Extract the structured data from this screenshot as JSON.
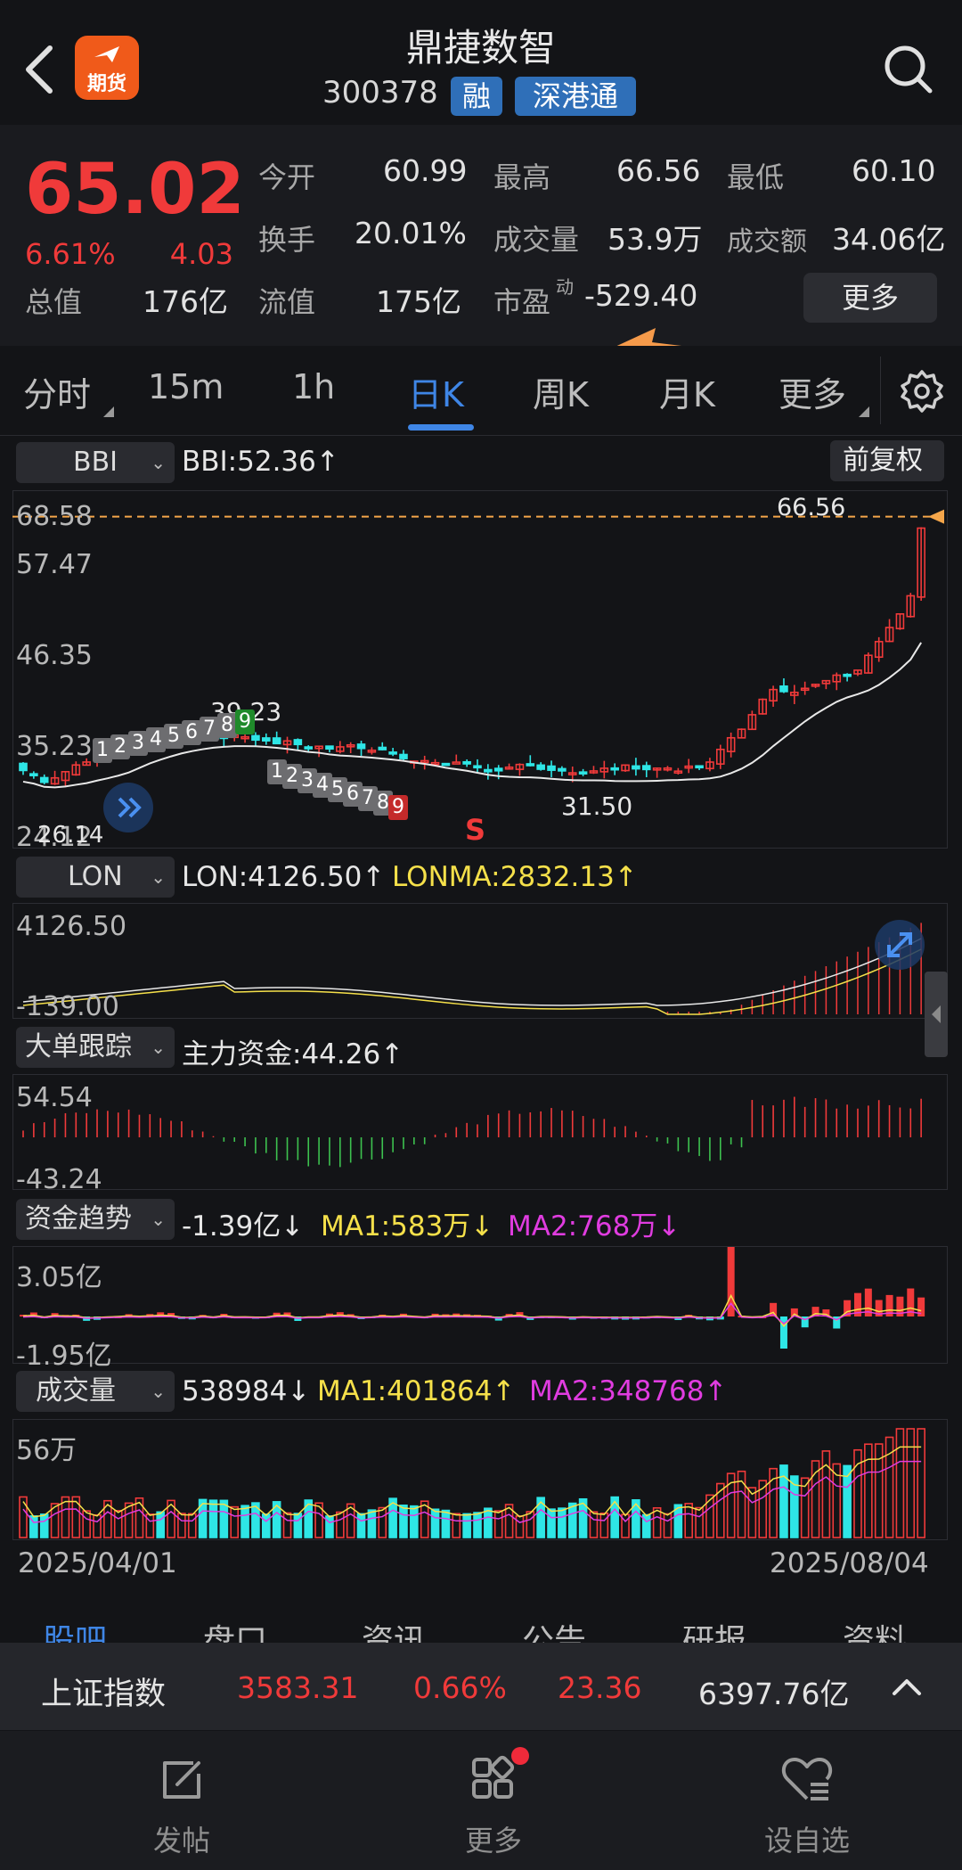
{
  "header": {
    "logo_text": "期货",
    "stock_name": "鼎捷数智",
    "stock_code": "300378",
    "tags": [
      "融",
      "深港通"
    ]
  },
  "quote": {
    "price": "65.02",
    "change_pct": "6.61%",
    "change_amt": "4.03",
    "total_value_label": "总值",
    "total_value": "176亿",
    "rows": [
      [
        {
          "label": "今开",
          "value": "60.99"
        },
        {
          "label": "最高",
          "value": "66.56"
        },
        {
          "label": "最低",
          "value": "60.10"
        }
      ],
      [
        {
          "label": "换手",
          "value": "20.01%"
        },
        {
          "label": "成交量",
          "value": "53.9万"
        },
        {
          "label": "成交额",
          "value": "34.06亿"
        }
      ],
      [
        {
          "label": "流值",
          "value": "175亿"
        },
        {
          "label": "市盈",
          "sup": "动",
          "value": "-529.40"
        }
      ]
    ],
    "more_button": "更多"
  },
  "period_tabs": [
    "分时",
    "15m",
    "1h",
    "日K",
    "周K",
    "月K",
    "更多"
  ],
  "active_tab": "日K",
  "main_chart": {
    "indicator": "BBI",
    "indicator_value": "BBI:52.36↑",
    "adjust_button": "前复权",
    "y_labels": [
      "68.58",
      "57.47",
      "46.35",
      "35.23",
      "24.12"
    ],
    "high_label": "66.56",
    "marker_39": "39.23",
    "marker_low": "31.50",
    "marker_26": "26.14",
    "s_marker": "S",
    "td_bottom_seq": [
      "1",
      "2",
      "3",
      "4",
      "5",
      "6",
      "7",
      "8",
      "9"
    ],
    "td_top_seq": [
      "1",
      "2",
      "3",
      "4",
      "5",
      "6",
      "7",
      "8",
      "9"
    ]
  },
  "lon_panel": {
    "indicator": "LON",
    "value1": "LON:4126.50↑",
    "value2": "LONMA:2832.13↑",
    "y_top": "4126.50",
    "y_bottom": "-139.00"
  },
  "big_order_panel": {
    "indicator": "大单跟踪",
    "value1": "主力资金:44.26↑",
    "y_top": "54.54",
    "y_bottom": "-43.24"
  },
  "fund_trend_panel": {
    "indicator": "资金趋势",
    "value1": "-1.39亿↓",
    "value2": "MA1:583万↓",
    "value3": "MA2:768万↓",
    "y_top": "3.05亿",
    "y_bottom": "-1.95亿"
  },
  "volume_panel": {
    "indicator": "成交量",
    "value1": "538984↓",
    "value2": "MA1:401864↑",
    "value3": "MA2:348768↑",
    "y_top": "56万",
    "date_start": "2025/04/01",
    "date_end": "2025/08/04"
  },
  "section_tabs": [
    "股吧",
    "盘口",
    "资讯",
    "公告",
    "研报",
    "资料"
  ],
  "index_bar": {
    "name": "上证指数",
    "value": "3583.31",
    "pct": "0.66%",
    "change": "23.36",
    "turnover": "6397.76亿"
  },
  "bottom_nav": [
    {
      "label": "发帖",
      "icon": "edit-icon"
    },
    {
      "label": "更多",
      "icon": "apps-icon"
    },
    {
      "label": "设自选",
      "icon": "heart-list-icon"
    }
  ],
  "colors": {
    "up": "#f03a3a",
    "down": "#2ee6e6",
    "accent": "#3f86e6",
    "arrow": "#f59a4a"
  }
}
